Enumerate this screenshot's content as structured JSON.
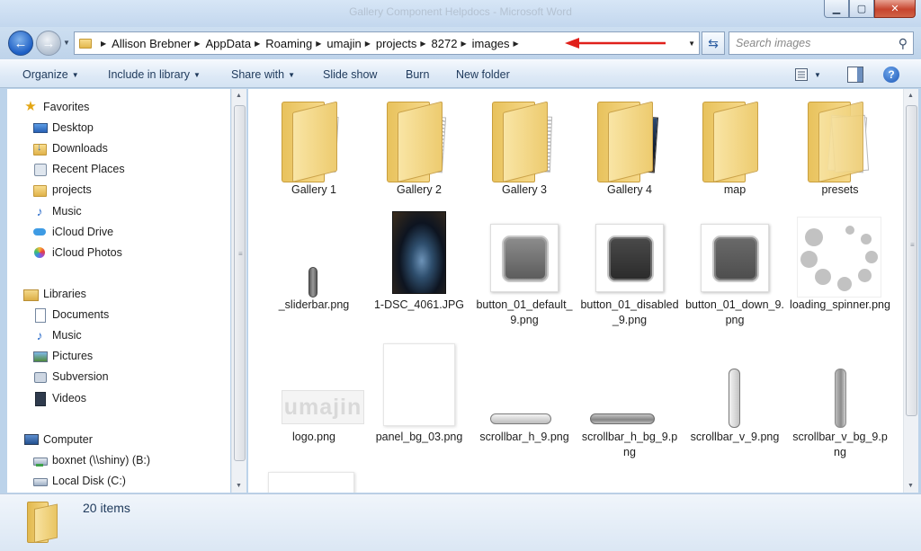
{
  "window": {
    "title": "Gallery Component Helpdocs - Microsoft Word",
    "minimize_glyph": "▁",
    "maximize_glyph": "▢",
    "close_glyph": "✕"
  },
  "address_bar": {
    "breadcrumbs": [
      "Allison Brebner",
      "AppData",
      "Roaming",
      "umajin",
      "projects",
      "8272",
      "images"
    ],
    "annotation_arrow_color": "#e0201b"
  },
  "search": {
    "placeholder": "Search images"
  },
  "toolbar": {
    "organize": "Organize",
    "include_in_library": "Include in library",
    "share_with": "Share with",
    "slide_show": "Slide show",
    "burn": "Burn",
    "new_folder": "New folder",
    "help": "?"
  },
  "sidebar": {
    "favorites": {
      "header": "Favorites",
      "items": [
        {
          "label": "Desktop",
          "icon": "desktop-icon"
        },
        {
          "label": "Downloads",
          "icon": "downloads-icon"
        },
        {
          "label": "Recent Places",
          "icon": "recent-places-icon"
        },
        {
          "label": "projects",
          "icon": "folder-icon"
        },
        {
          "label": "Music",
          "icon": "music-icon"
        },
        {
          "label": "iCloud Drive",
          "icon": "icloud-icon"
        },
        {
          "label": "iCloud Photos",
          "icon": "photos-icon"
        }
      ]
    },
    "libraries": {
      "header": "Libraries",
      "items": [
        {
          "label": "Documents",
          "icon": "documents-icon"
        },
        {
          "label": "Music",
          "icon": "music-icon"
        },
        {
          "label": "Pictures",
          "icon": "pictures-icon"
        },
        {
          "label": "Subversion",
          "icon": "subversion-icon"
        },
        {
          "label": "Videos",
          "icon": "videos-icon"
        }
      ]
    },
    "computer": {
      "header": "Computer",
      "items": [
        {
          "label": "boxnet (\\\\shiny) (B:)",
          "icon": "network-drive-icon"
        },
        {
          "label": "Local Disk (C:)",
          "icon": "local-disk-icon"
        }
      ]
    }
  },
  "files": [
    {
      "name": "Gallery 1",
      "kind": "folder",
      "preview": "papers"
    },
    {
      "name": "Gallery 2",
      "kind": "folder",
      "preview": "document"
    },
    {
      "name": "Gallery 3",
      "kind": "folder",
      "preview": "table"
    },
    {
      "name": "Gallery 4",
      "kind": "folder",
      "preview": "photo"
    },
    {
      "name": "map",
      "kind": "folder",
      "preview": "empty"
    },
    {
      "name": "presets",
      "kind": "folder",
      "preview": "white"
    },
    {
      "name": "_sliderbar.png",
      "kind": "image",
      "preview": "slider-pill"
    },
    {
      "name": "1-DSC_4061.JPG",
      "kind": "image",
      "preview": "night-photo"
    },
    {
      "name": "button_01_default_9.png",
      "kind": "image",
      "preview": "button-default"
    },
    {
      "name": "button_01_disabled_9.png",
      "kind": "image",
      "preview": "button-disabled"
    },
    {
      "name": "button_01_down_9.png",
      "kind": "image",
      "preview": "button-down"
    },
    {
      "name": "loading_spinner.png",
      "kind": "image",
      "preview": "spinner"
    },
    {
      "name": "logo.png",
      "kind": "image",
      "preview": "logo",
      "logo_text": "umajin"
    },
    {
      "name": "panel_bg_03.png",
      "kind": "image",
      "preview": "panel"
    },
    {
      "name": "scrollbar_h_9.png",
      "kind": "image",
      "preview": "hbar"
    },
    {
      "name": "scrollbar_h_bg_9.png",
      "kind": "image",
      "preview": "hbar-bg"
    },
    {
      "name": "scrollbar_v_9.png",
      "kind": "image",
      "preview": "vbar"
    },
    {
      "name": "scrollbar_v_bg_9.png",
      "kind": "image",
      "preview": "vbar-bg"
    }
  ],
  "status": {
    "item_count": "20 items"
  }
}
